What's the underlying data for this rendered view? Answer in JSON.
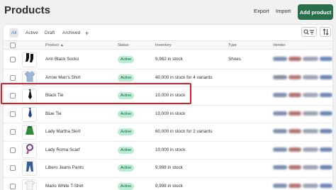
{
  "header": {
    "title": "Products",
    "export_label": "Export",
    "import_label": "Import",
    "add_label": "Add product"
  },
  "tabs": [
    "All",
    "Active",
    "Draft",
    "Archived"
  ],
  "columns": {
    "product": "Product",
    "status": "Status",
    "inventory": "Inventory",
    "type": "Type",
    "vendor": "Vendor"
  },
  "rows": [
    {
      "name": "Arin Black Socks",
      "status": "Active",
      "inventory": "9,982 in stock",
      "type": "Shoes",
      "thumb_icon": "socks-icon"
    },
    {
      "name": "Arrow Men's Shirt",
      "status": "Active",
      "inventory": "40,000 in stock for 4 variants",
      "type": "",
      "thumb_icon": "shirt-icon"
    },
    {
      "name": "Black Tie",
      "status": "Active",
      "inventory": "10,000 in stock",
      "type": "",
      "thumb_icon": "tie-icon"
    },
    {
      "name": "Blue Tie",
      "status": "Active",
      "inventory": "10,000 in stock",
      "type": "",
      "thumb_icon": "tie-icon"
    },
    {
      "name": "Lady Martha Skirt",
      "status": "Active",
      "inventory": "60,000 in stock for 2 variants",
      "type": "",
      "thumb_icon": "skirt-icon"
    },
    {
      "name": "Lady Roma Scarf",
      "status": "Active",
      "inventory": "10,000 in stock",
      "type": "",
      "thumb_icon": "scarf-icon"
    },
    {
      "name": "Libero Jeans Pants",
      "status": "Active",
      "inventory": "9,998 in stock",
      "type": "",
      "thumb_icon": "jeans-icon"
    },
    {
      "name": "Mario White T-Shirt",
      "status": "Active",
      "inventory": "9,998 in stock",
      "type": "",
      "thumb_icon": "tshirt-icon"
    }
  ],
  "colors": {
    "primary_button": "#2b6e4c",
    "active_badge_bg": "#b8ecd4",
    "active_badge_text": "#185c37",
    "highlight_border": "#d81f26"
  }
}
